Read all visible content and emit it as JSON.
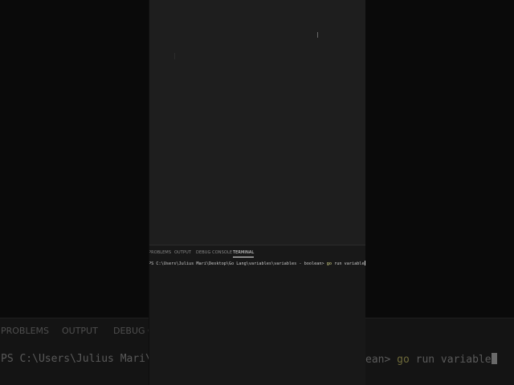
{
  "panel": {
    "tabs": [
      "PROBLEMS",
      "OUTPUT",
      "DEBUG CONSOLE",
      "TERMINAL"
    ],
    "active_tab": "TERMINAL"
  },
  "terminal": {
    "prompt": "PS C:\\Users\\Julius Mari\\Desktop\\Go Lang\\variables\\variables - boolean>",
    "command_go": "go",
    "command_args": " run variable"
  },
  "background": {
    "tab_problems": "PROBLEMS",
    "tab_output": "OUTPUT",
    "tab_debug_partial": "DEBUG C",
    "prompt_left": "PS C:\\Users\\Julius Mari\\Desk",
    "prompt_right_tail": "ean>",
    "command_go": "go",
    "command_args": " run variable"
  },
  "colors": {
    "background": "#0a0a0a",
    "editor": "#1e1e1e",
    "panel": "#181818",
    "active_tab_text": "#e6e6e6",
    "command_keyword": "#dcdc8a"
  }
}
